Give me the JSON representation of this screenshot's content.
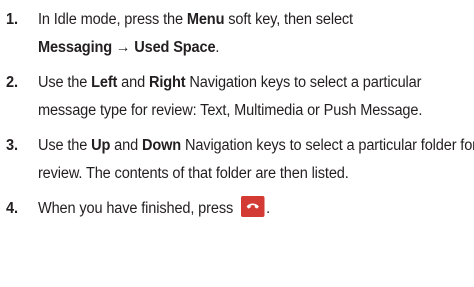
{
  "steps": [
    {
      "number": "1.",
      "pre": "In Idle mode, press the ",
      "key1": "Menu",
      "mid": " soft key, then select ",
      "path": "Messaging → Used Space",
      "post": "."
    },
    {
      "number": "2.",
      "pre": "Use the ",
      "key1": "Left",
      "mid": " and ",
      "key2": "Right",
      "post": " Navigation keys to select a particular message type for review: Text, Multimedia or Push Message."
    },
    {
      "number": "3.",
      "pre": "Use the ",
      "key1": "Up",
      "mid": " and ",
      "key2": "Down",
      "post": " Navigation keys to select a particular folder for review. The contents of that folder are then listed."
    },
    {
      "number": "4.",
      "pre": "When you have finished, press ",
      "icon": "end-call-key-icon",
      "post": "."
    }
  ],
  "colors": {
    "text": "#231f20",
    "end_key": "#d23a33"
  }
}
